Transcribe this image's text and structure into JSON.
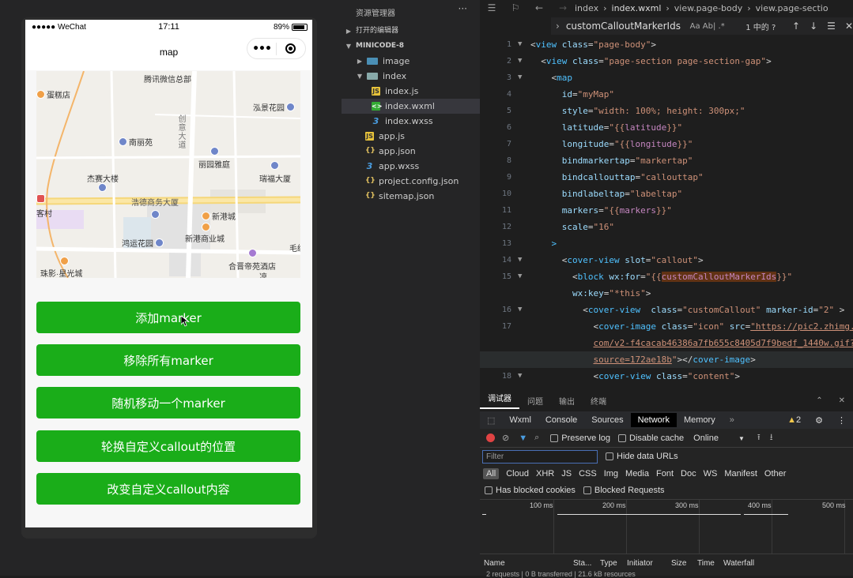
{
  "phone": {
    "status": {
      "signal": "●●●●● WeChat",
      "time": "17:11",
      "battery": "89%"
    },
    "nav_title": "map",
    "capsule_more": "•••",
    "map": {
      "pois": [
        "蛋糕店",
        "腾讯微信总部",
        "泓景花园",
        "南丽苑",
        "丽园雅庭",
        "杰赛大楼",
        "瑞福大厦",
        "浩德商务大厦",
        "客村",
        "新港城",
        "新港商业城",
        "鸿运花园",
        "合晋帝苑酒店",
        "毛纺",
        "珠影·星光城",
        "凉"
      ],
      "road_vertical": "创意大道"
    },
    "buttons": [
      "添加marker",
      "移除所有marker",
      "随机移动一个marker",
      "轮换自定义callout的位置",
      "改变自定义callout内容"
    ]
  },
  "explorer": {
    "title": "资源管理器",
    "more": "···",
    "items": [
      {
        "label": "打开的编辑器",
        "type": "section"
      },
      {
        "label": "MINICODE-8",
        "type": "section"
      },
      {
        "label": "image",
        "type": "folder"
      },
      {
        "label": "index",
        "type": "folder-open"
      },
      {
        "label": "index.js",
        "type": "js"
      },
      {
        "label": "index.wxml",
        "type": "wxml"
      },
      {
        "label": "index.wxss",
        "type": "wxss"
      },
      {
        "label": "app.js",
        "type": "js"
      },
      {
        "label": "app.json",
        "type": "json"
      },
      {
        "label": "app.wxss",
        "type": "wxss"
      },
      {
        "label": "project.config.json",
        "type": "json"
      },
      {
        "label": "sitemap.json",
        "type": "json"
      }
    ]
  },
  "editor": {
    "breadcrumb": [
      "index",
      "index.wxml",
      "view.page-body",
      "view.page-sectio"
    ],
    "find": {
      "value": "customCalloutMarkerIds",
      "options": "Aa  Ab|  .*",
      "count": "1 中的 ?"
    }
  },
  "devtools": {
    "top_tabs": [
      "调试器",
      "问题",
      "输出",
      "终端"
    ],
    "panel_tabs": [
      "Wxml",
      "Console",
      "Sources",
      "Network",
      "Memory"
    ],
    "warn_count": "2",
    "preserve_log": "Preserve log",
    "disable_cache": "Disable cache",
    "throttle": "Online",
    "filter_placeholder": "Filter",
    "hide_data_urls": "Hide data URLs",
    "types": [
      "All",
      "Cloud",
      "XHR",
      "JS",
      "CSS",
      "Img",
      "Media",
      "Font",
      "Doc",
      "WS",
      "Manifest",
      "Other"
    ],
    "has_blocked": "Has blocked cookies",
    "blocked_requests": "Blocked Requests",
    "ticks": [
      "100 ms",
      "200 ms",
      "300 ms",
      "400 ms",
      "500 ms"
    ],
    "columns": [
      "Name",
      "Sta...",
      "Type",
      "Initiator",
      "Size",
      "Time",
      "Waterfall"
    ],
    "summary": "2 requests | 0 B transferred | 21.6 kB resources"
  }
}
